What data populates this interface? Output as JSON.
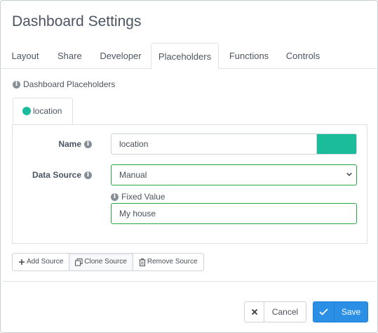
{
  "dialog": {
    "title": "Dashboard Settings"
  },
  "tabs": [
    {
      "label": "Layout"
    },
    {
      "label": "Share"
    },
    {
      "label": "Developer"
    },
    {
      "label": "Placeholders",
      "active": true
    },
    {
      "label": "Functions"
    },
    {
      "label": "Controls"
    }
  ],
  "placeholders": {
    "section_label": "Dashboard Placeholders",
    "items": [
      {
        "label": "location",
        "color": "#1abc9c"
      }
    ],
    "form": {
      "name_label": "Name",
      "name_value": "location",
      "color": "#1abc9c",
      "data_source_label": "Data Source",
      "data_source_value": "Manual",
      "fixed_value_label": "Fixed Value",
      "fixed_value": "My house"
    },
    "source_buttons": {
      "add": "Add Source",
      "clone": "Clone Source",
      "remove": "Remove Source"
    }
  },
  "footer": {
    "cancel_label": "Cancel",
    "save_label": "Save"
  },
  "colors": {
    "accent": "#2c8fe6",
    "placeholder": "#1abc9c",
    "valid_border": "#28a745"
  },
  "icons": [
    "info-icon",
    "chevron-down-icon",
    "plus-icon",
    "clone-icon",
    "trash-icon",
    "close-icon",
    "check-icon"
  ]
}
